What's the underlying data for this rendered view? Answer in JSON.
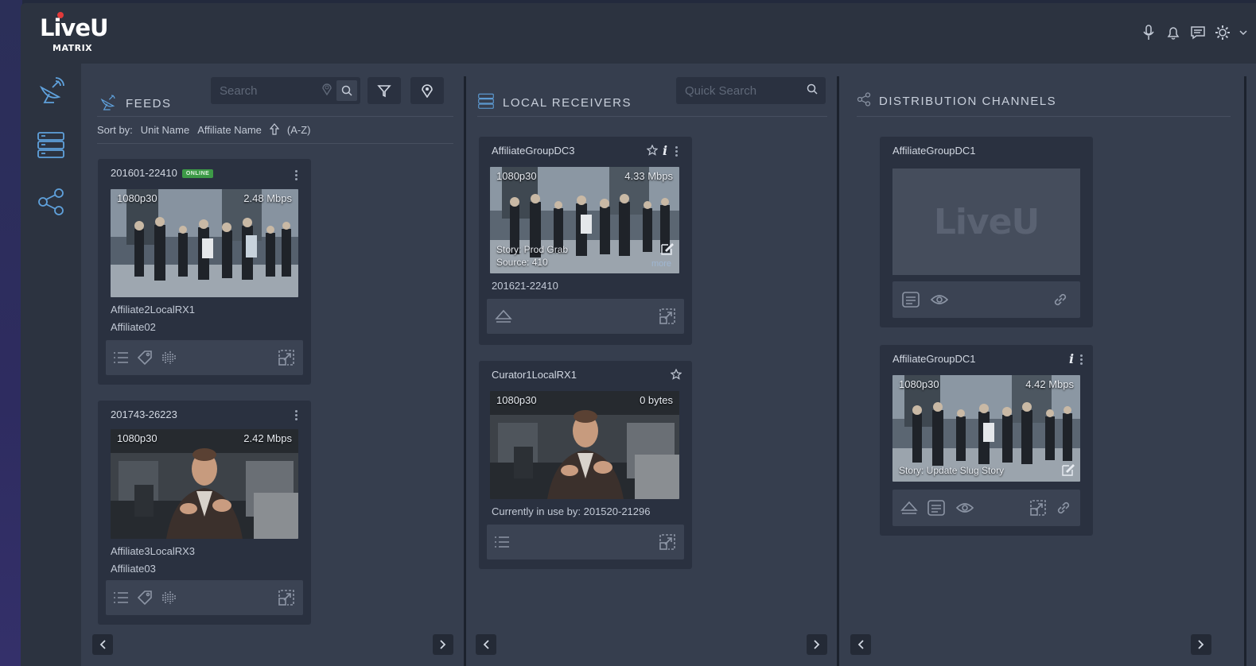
{
  "brand": {
    "logo_main": "LiveU",
    "logo_sub": "MATRIX"
  },
  "colors": {
    "accent": "#5fa1dc",
    "online": "#3d9a47",
    "logo_red": "#e03a3a"
  },
  "header": {
    "icons": [
      "microphone-icon",
      "bell-icon",
      "chat-icon",
      "settings-icon",
      "chevron-down-icon"
    ]
  },
  "sidebar": {
    "items": [
      "satellite-icon",
      "server-stack-icon",
      "share-network-icon"
    ]
  },
  "feeds": {
    "title": "FEEDS",
    "search_placeholder": "Search",
    "sort_label": "Sort by:",
    "sort_options": [
      "Unit Name",
      "Affiliate Name"
    ],
    "sort_order": "(A-Z)",
    "cards": [
      {
        "id": "201601-22410",
        "status": "ONLINE",
        "resolution": "1080p30",
        "bitrate": "2.48 Mbps",
        "line1": "Affiliate2LocalRX1",
        "line2": "Affiliate02"
      },
      {
        "id": "201743-26223",
        "status": "",
        "resolution": "1080p30",
        "bitrate": "2.42 Mbps",
        "line1": "Affiliate3LocalRX3",
        "line2": "Affiliate03"
      }
    ]
  },
  "receivers": {
    "title": "LOCAL RECEIVERS",
    "search_placeholder": "Quick Search",
    "cards": [
      {
        "name": "AffiliateGroupDC3",
        "resolution": "1080p30",
        "bitrate": "4.33 Mbps",
        "story": "Story: Prod Grab",
        "source": "Source: 410",
        "more": "more",
        "footer": "201621-22410"
      },
      {
        "name": "Curator1LocalRX1",
        "resolution": "1080p30",
        "bitrate": "0 bytes",
        "footer": "Currently in use by: 201520-21296"
      }
    ]
  },
  "distribution": {
    "title": "DISTRIBUTION CHANNELS",
    "cards": [
      {
        "name": "AffiliateGroupDC1",
        "placeholder_logo": "LiveU"
      },
      {
        "name": "AffiliateGroupDC1",
        "resolution": "1080p30",
        "bitrate": "4.42 Mbps",
        "story": "Story: Update Slug Story"
      }
    ]
  }
}
